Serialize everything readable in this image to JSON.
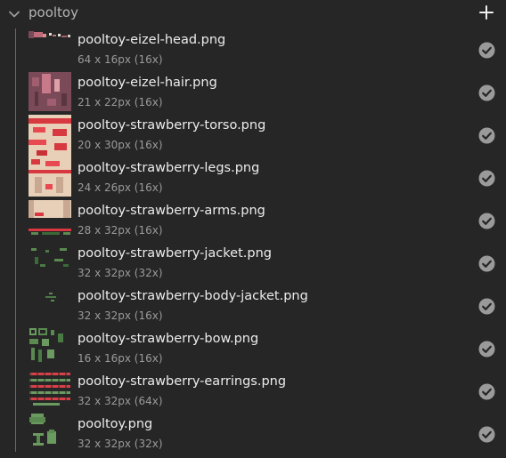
{
  "folder": {
    "title": "pooltoy",
    "expand_icon": "chevron-down-icon",
    "add_icon": "plus-icon"
  },
  "items": [
    {
      "name": "pooltoy-eizel-head.png",
      "meta": "64 x 16px (16x)",
      "status_icon": "check-circle-icon"
    },
    {
      "name": "pooltoy-eizel-hair.png",
      "meta": "21 x 22px (16x)",
      "status_icon": "check-circle-icon"
    },
    {
      "name": "pooltoy-strawberry-torso.png",
      "meta": "20 x 30px (16x)",
      "status_icon": "check-circle-icon"
    },
    {
      "name": "pooltoy-strawberry-legs.png",
      "meta": "24 x 26px (16x)",
      "status_icon": "check-circle-icon"
    },
    {
      "name": "pooltoy-strawberry-arms.png",
      "meta": "28 x 32px (16x)",
      "status_icon": "check-circle-icon"
    },
    {
      "name": "pooltoy-strawberry-jacket.png",
      "meta": "32 x 32px (32x)",
      "status_icon": "check-circle-icon"
    },
    {
      "name": "pooltoy-strawberry-body-jacket.png",
      "meta": "32 x 32px (16x)",
      "status_icon": "check-circle-icon"
    },
    {
      "name": "pooltoy-strawberry-bow.png",
      "meta": "16 x 16px (16x)",
      "status_icon": "check-circle-icon"
    },
    {
      "name": "pooltoy-strawberry-earrings.png",
      "meta": "32 x 32px (64x)",
      "status_icon": "check-circle-icon"
    },
    {
      "name": "pooltoy.png",
      "meta": "32 x 32px (32x)",
      "status_icon": "check-circle-icon"
    }
  ],
  "colors": {
    "background": "#262626",
    "check_fill": "#9a9a9a",
    "tree_line": "#6a6a6a"
  }
}
